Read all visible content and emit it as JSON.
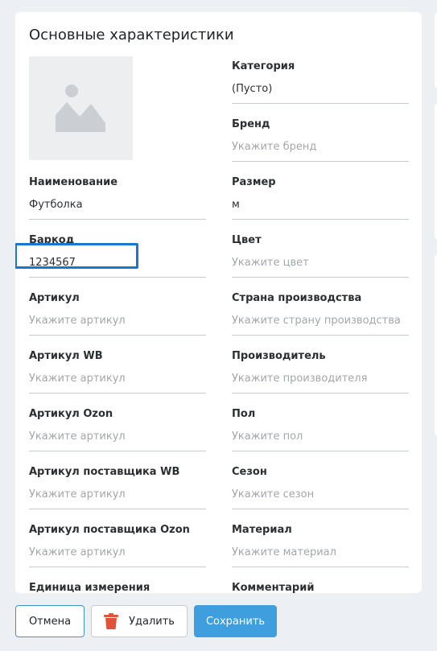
{
  "title": "Основные характеристики",
  "fields_left": [
    {
      "label": "Наименование",
      "value": "Футболка",
      "placeholder": false
    },
    {
      "label": "Баркод",
      "value": "1234567",
      "placeholder": false
    },
    {
      "label": "Артикул",
      "value": "Укажите артикул",
      "placeholder": true
    },
    {
      "label": "Артикул WB",
      "value": "Укажите артикул",
      "placeholder": true
    },
    {
      "label": "Артикул Ozon",
      "value": "Укажите артикул",
      "placeholder": true
    },
    {
      "label": "Артикул поставщика WB",
      "value": "Укажите артикул",
      "placeholder": true
    },
    {
      "label": "Артикул поставщика Ozon",
      "value": "Укажите артикул",
      "placeholder": true
    },
    {
      "label": "Единица измерения"
    }
  ],
  "fields_right": [
    {
      "label": "Категория",
      "value": "(Пусто)",
      "placeholder": false
    },
    {
      "label": "Бренд",
      "value": "Укажите бренд",
      "placeholder": true
    },
    {
      "label": "Размер",
      "value": "м",
      "placeholder": false
    },
    {
      "label": "Цвет",
      "value": "Укажите цвет",
      "placeholder": true
    },
    {
      "label": "Страна производства",
      "value": "Укажите страну производства",
      "placeholder": true
    },
    {
      "label": "Производитель",
      "value": "Укажите производителя",
      "placeholder": true
    },
    {
      "label": "Пол",
      "value": "Укажите пол",
      "placeholder": true
    },
    {
      "label": "Сезон",
      "value": "Укажите сезон",
      "placeholder": true
    },
    {
      "label": "Материал",
      "value": "Укажите материал",
      "placeholder": true
    },
    {
      "label": "Комментарий"
    }
  ],
  "buttons": {
    "cancel": "Отмена",
    "delete": "Удалить",
    "save": "Сохранить"
  },
  "icons": {
    "image_placeholder": "image-placeholder-icon",
    "delete": "trash-icon"
  },
  "colors": {
    "accent": "#3f9fde",
    "focus_outline": "#1976d2",
    "delete_icon": "#e0533a"
  }
}
